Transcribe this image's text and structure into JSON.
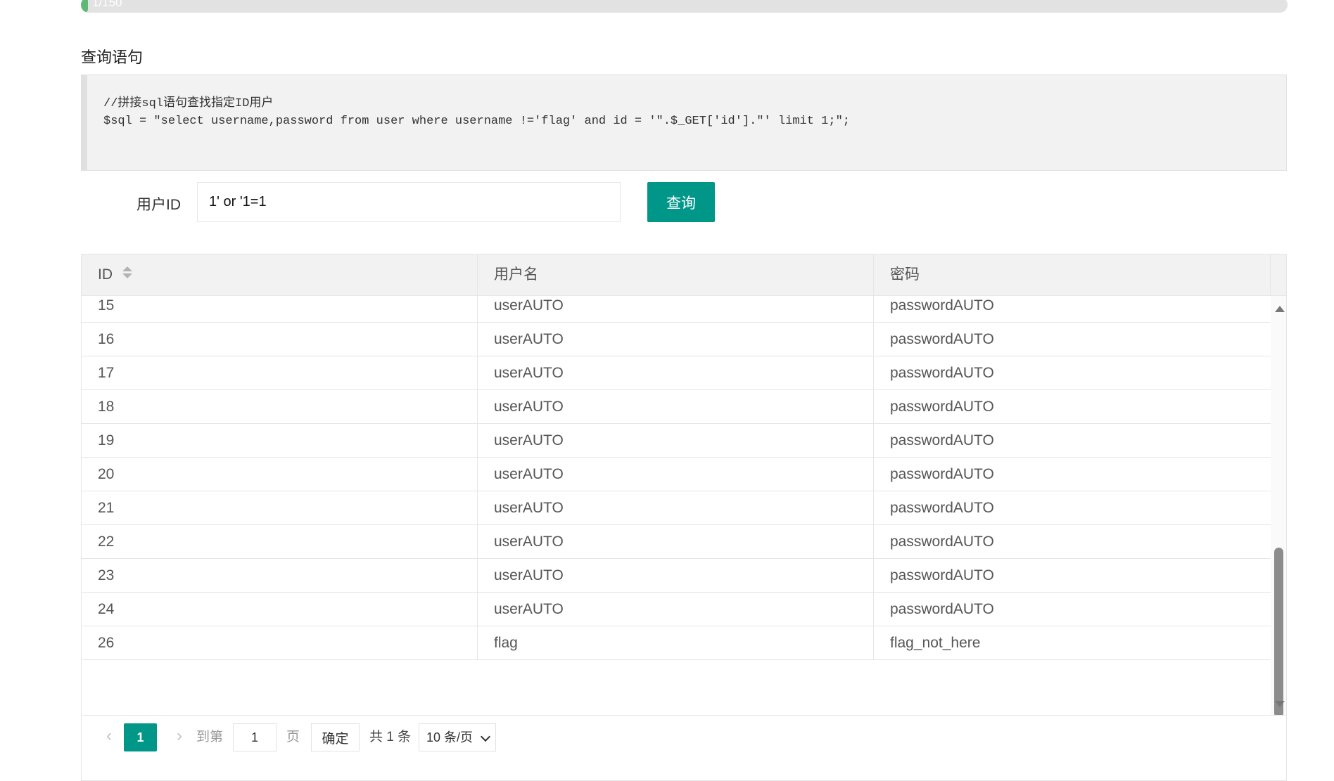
{
  "progress": {
    "label": "1/150",
    "value": 0.00667
  },
  "section_title": "查询语句",
  "code": {
    "line1": "//拼接sql语句查找指定ID用户",
    "line2": "$sql = \"select username,password from user where username !='flag' and id = '\".$_GET['id'].\"' limit 1;\";"
  },
  "form": {
    "label": "用户ID",
    "input_value": "1' or '1=1",
    "button_label": "查询"
  },
  "table": {
    "headers": [
      "ID",
      "用户名",
      "密码"
    ],
    "rows": [
      [
        "15",
        "userAUTO",
        "passwordAUTO"
      ],
      [
        "16",
        "userAUTO",
        "passwordAUTO"
      ],
      [
        "17",
        "userAUTO",
        "passwordAUTO"
      ],
      [
        "18",
        "userAUTO",
        "passwordAUTO"
      ],
      [
        "19",
        "userAUTO",
        "passwordAUTO"
      ],
      [
        "20",
        "userAUTO",
        "passwordAUTO"
      ],
      [
        "21",
        "userAUTO",
        "passwordAUTO"
      ],
      [
        "22",
        "userAUTO",
        "passwordAUTO"
      ],
      [
        "23",
        "userAUTO",
        "passwordAUTO"
      ],
      [
        "24",
        "userAUTO",
        "passwordAUTO"
      ],
      [
        "26",
        "flag",
        "flag_not_here"
      ]
    ]
  },
  "pagination": {
    "prev_icon": "chevron-left-icon",
    "next_icon": "chevron-right-icon",
    "current_page": "1",
    "goto_label": "到第",
    "goto_value": "1",
    "page_unit": "页",
    "confirm_label": "确定",
    "total_label": "共 1 条",
    "page_size_label": "10 条/页"
  },
  "colors": {
    "accent": "#009688",
    "progress": "#5fb878",
    "header_bg": "#f2f2f2",
    "border": "#e6e6e6"
  }
}
